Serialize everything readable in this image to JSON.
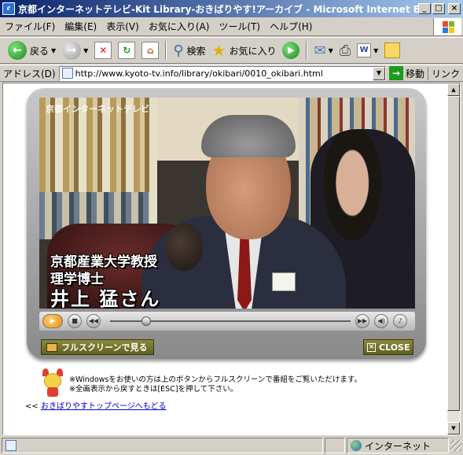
{
  "window": {
    "title": "京都インターネットテレビ-Kit Library-おきばりやす!アーカイブ - Microsoft Internet Explorer",
    "minimize": "_",
    "maximize": "□",
    "close": "×"
  },
  "menu": [
    "ファイル(F)",
    "編集(E)",
    "表示(V)",
    "お気に入り(A)",
    "ツール(T)",
    "ヘルプ(H)"
  ],
  "toolbar": {
    "back": "戻る",
    "search": "検索",
    "favorites": "お気に入り"
  },
  "address": {
    "label": "アドレス(D)",
    "url": "http://www.kyoto-tv.info/library/okibari/0010_okibari.html",
    "go": "移動",
    "links": "リンク"
  },
  "player": {
    "watermark": "京都インターネットテレビ",
    "caption_line1": "京都産業大学教授",
    "caption_line2": "理学博士",
    "caption_name": "井上 猛さん",
    "seek_fraction": 0.15,
    "fullscreen_label": "フルスクリーンで見る",
    "close_label": "CLOSE"
  },
  "notes": {
    "line1": "※Windowsをお使いの方は上のボタンからフルスクリーンで番組をご覧いただけます。",
    "line2": "※全画表示から戻すときは[ESC]を押して下さい。"
  },
  "backlink": {
    "prefix": "<<",
    "text": "おきばりやすトップページへもどる"
  },
  "status": {
    "zone": "インターネット"
  }
}
